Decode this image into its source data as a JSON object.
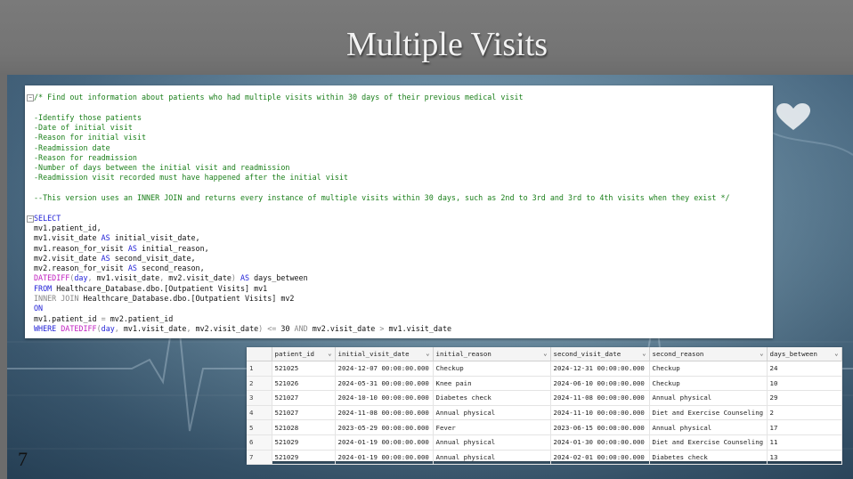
{
  "slide": {
    "title": "Multiple Visits",
    "number": "7"
  },
  "query": {
    "comment_lines": [
      "/* Find out information about patients who had multiple visits within 30 days of their previous medical visit",
      "",
      "-Identify those patients",
      "-Date of initial visit",
      "-Reason for initial visit",
      "-Readmission date",
      "-Reason for readmission",
      "-Number of days between the initial visit and readmission",
      "-Readmission visit recorded must have happened after the initial visit",
      "",
      "--This version uses an INNER JOIN and returns every instance of multiple visits within 30 days, such as 2nd to 3rd and 3rd to 4th visits when they exist */"
    ],
    "sql_lines": [
      [
        {
          "k": "SELECT"
        }
      ],
      [
        {
          "t": "mv1.patient_id,"
        }
      ],
      [
        {
          "t": "mv1.visit_date "
        },
        {
          "k": "AS"
        },
        {
          "t": " initial_visit_date,"
        }
      ],
      [
        {
          "t": "mv1.reason_for_visit "
        },
        {
          "k": "AS"
        },
        {
          "t": " initial_reason,"
        }
      ],
      [
        {
          "t": "mv2.visit_date "
        },
        {
          "k": "AS"
        },
        {
          "t": " second_visit_date,"
        }
      ],
      [
        {
          "t": "mv2.reason_for_visit "
        },
        {
          "k": "AS"
        },
        {
          "t": " second_reason,"
        }
      ],
      [
        {
          "f": "DATEDIFF"
        },
        {
          "g": "("
        },
        {
          "k": "day"
        },
        {
          "g": ","
        },
        {
          "t": " mv1.visit_date"
        },
        {
          "g": ","
        },
        {
          "t": " mv2.visit_date"
        },
        {
          "g": ")"
        },
        {
          "t": " "
        },
        {
          "k": "AS"
        },
        {
          "t": " days_between"
        }
      ],
      [
        {
          "k": "FROM"
        },
        {
          "t": " Healthcare_Database.dbo.[Outpatient Visits] mv1"
        }
      ],
      [
        {
          "g": "INNER JOIN"
        },
        {
          "t": " Healthcare_Database.dbo.[Outpatient Visits] mv2"
        }
      ],
      [
        {
          "k": "ON"
        }
      ],
      [
        {
          "t": "mv1.patient_id "
        },
        {
          "g": "="
        },
        {
          "t": " mv2.patient_id"
        }
      ],
      [
        {
          "k": "WHERE"
        },
        {
          "t": " "
        },
        {
          "f": "DATEDIFF"
        },
        {
          "g": "("
        },
        {
          "k": "day"
        },
        {
          "g": ","
        },
        {
          "t": " mv1.visit_date"
        },
        {
          "g": ","
        },
        {
          "t": " mv2.visit_date"
        },
        {
          "g": ")"
        },
        {
          "t": " "
        },
        {
          "g": "<="
        },
        {
          "t": " 30 "
        },
        {
          "g": "AND"
        },
        {
          "t": " mv2.visit_date "
        },
        {
          "g": ">"
        },
        {
          "t": " mv1.visit_date"
        }
      ]
    ]
  },
  "results": {
    "columns": [
      "",
      "patient_id",
      "initial_visit_date",
      "initial_reason",
      "second_visit_date",
      "second_reason",
      "days_between"
    ],
    "rows": [
      [
        "1",
        "521025",
        "2024-12-07 00:00:00.000",
        "Checkup",
        "2024-12-31 00:00:00.000",
        "Checkup",
        "24"
      ],
      [
        "2",
        "521026",
        "2024-05-31 00:00:00.000",
        "Knee pain",
        "2024-06-10 00:00:00.000",
        "Checkup",
        "10"
      ],
      [
        "3",
        "521027",
        "2024-10-10 00:00:00.000",
        "Diabetes check",
        "2024-11-08 00:00:00.000",
        "Annual physical",
        "29"
      ],
      [
        "4",
        "521027",
        "2024-11-08 00:00:00.000",
        "Annual physical",
        "2024-11-10 00:00:00.000",
        "Diet and Exercise Counseling",
        "2"
      ],
      [
        "5",
        "521028",
        "2023-05-29 00:00:00.000",
        "Fever",
        "2023-06-15 00:00:00.000",
        "Annual physical",
        "17"
      ],
      [
        "6",
        "521029",
        "2024-01-19 00:00:00.000",
        "Annual physical",
        "2024-01-30 00:00:00.000",
        "Diet and Exercise Counseling",
        "11"
      ],
      [
        "7",
        "521029",
        "2024-01-19 00:00:00.000",
        "Annual physical",
        "2024-02-01 00:00:00.000",
        "Diabetes check",
        "13"
      ]
    ]
  },
  "colors": {
    "comment": "#1a7f1a",
    "keyword": "#1f1fd6",
    "function": "#c020c0",
    "operator": "#888888"
  },
  "icons": [
    "heart-icon",
    "collapse-icon",
    "chevron-down-icon"
  ]
}
